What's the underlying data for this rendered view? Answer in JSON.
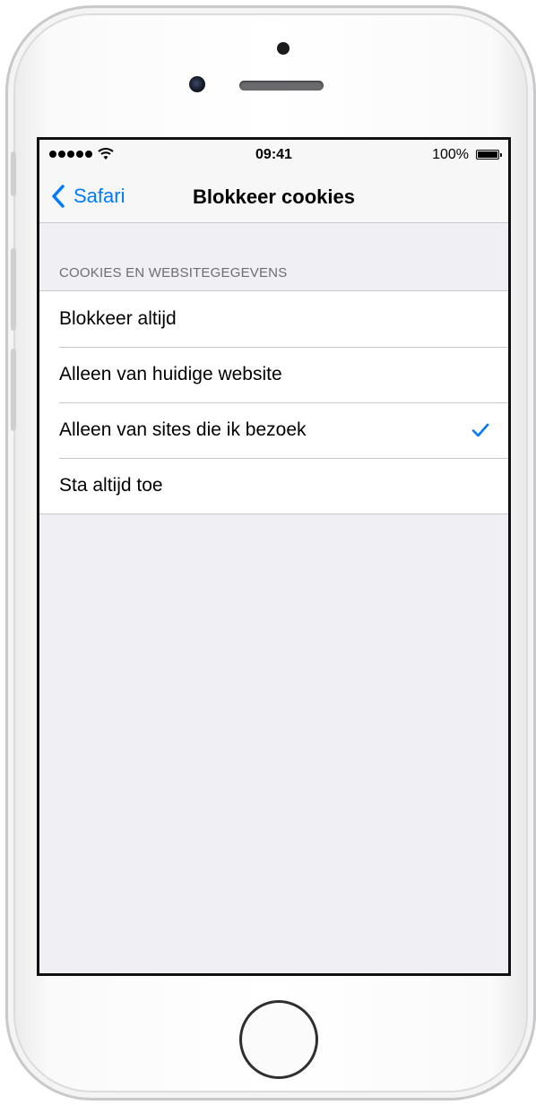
{
  "status_bar": {
    "time": "09:41",
    "battery_percent": "100%"
  },
  "nav": {
    "back_label": "Safari",
    "title": "Blokkeer cookies"
  },
  "section": {
    "header": "COOKIES EN WEBSITEGEGEVENS",
    "options": [
      {
        "label": "Blokkeer altijd",
        "selected": false
      },
      {
        "label": "Alleen van huidige website",
        "selected": false
      },
      {
        "label": "Alleen van sites die ik bezoek",
        "selected": true
      },
      {
        "label": "Sta altijd toe",
        "selected": false
      }
    ]
  },
  "colors": {
    "accent": "#007aff",
    "background": "#efeff4",
    "separator": "#c8c7cc",
    "section_header_text": "#6d6d72"
  },
  "icons": {
    "back": "chevron-left-icon",
    "selected": "checkmark-icon",
    "signal": "signal-dots-icon",
    "wifi": "wifi-icon",
    "battery": "battery-icon"
  }
}
